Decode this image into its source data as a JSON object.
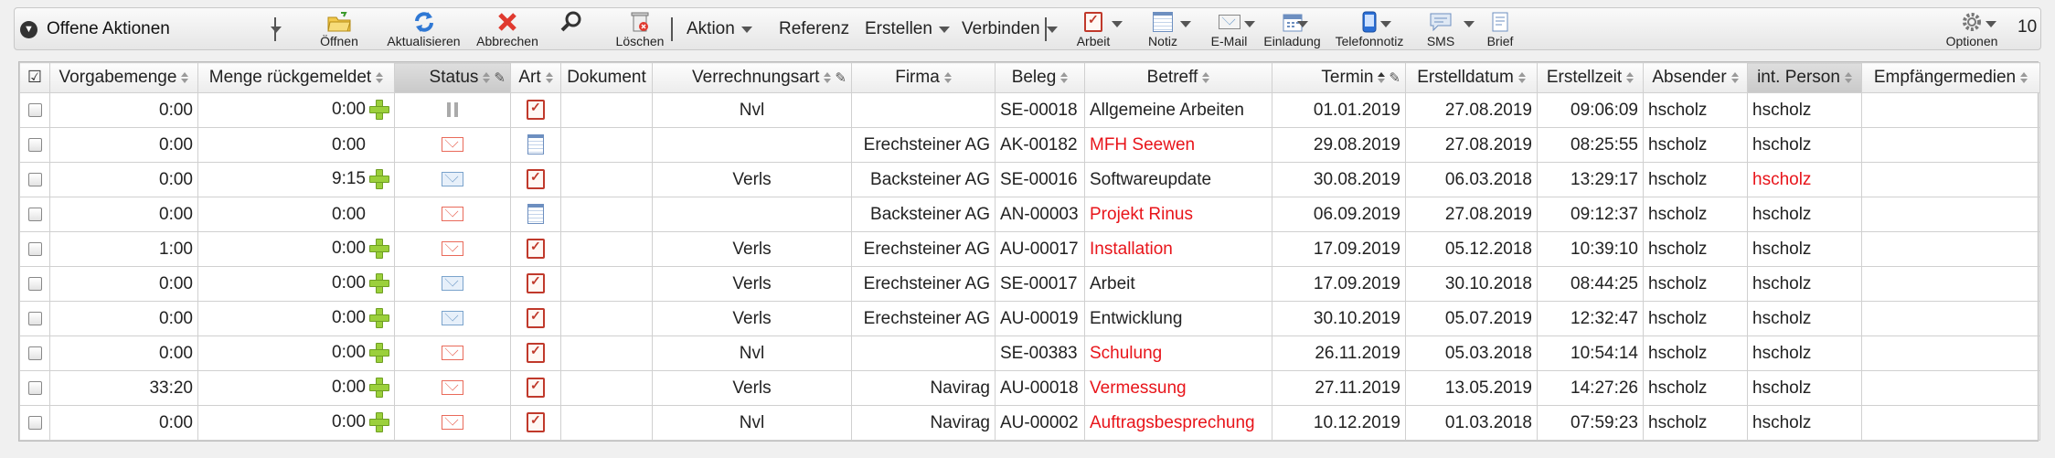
{
  "toolbar": {
    "view_title": "Offene Aktionen",
    "buttons": {
      "open": "Öffnen",
      "refresh": "Aktualisieren",
      "cancel": "Abbrechen",
      "delete": "Löschen",
      "arbeit": "Arbeit",
      "notiz": "Notiz",
      "email": "E-Mail",
      "einladung": "Einladung",
      "telefonnotiz": "Telefonnotiz",
      "sms": "SMS",
      "brief": "Brief",
      "optionen": "Optionen"
    },
    "menus": {
      "aktion": "Aktion",
      "referenz": "Referenz",
      "erstellen": "Erstellen",
      "verbinden": "Verbinden"
    },
    "page_size": "10"
  },
  "columns": {
    "vorgabemenge": "Vorgabemenge",
    "menge": "Menge rückgemeldet",
    "status": "Status",
    "art": "Art",
    "dokument": "Dokument",
    "verrechnungsart": "Verrechnungsart",
    "firma": "Firma",
    "beleg": "Beleg",
    "betreff": "Betreff",
    "termin": "Termin",
    "erstelldatum": "Erstelldatum",
    "erstellzeit": "Erstellzeit",
    "absender": "Absender",
    "int_person": "int. Person",
    "empfaenger": "Empfängermedien"
  },
  "rows": [
    {
      "vorgabe": "0:00",
      "menge": "0:00",
      "plus": true,
      "status": "pause",
      "art": "clip",
      "verr": "Nvl",
      "firma": "",
      "beleg": "SE-00018",
      "betreff": "Allgemeine Arbeiten",
      "betreff_red": false,
      "termin": "01.01.2019",
      "erstelldatum": "27.08.2019",
      "erstellzeit": "09:06:09",
      "absender": "hscholz",
      "int_person": "hscholz",
      "int_red": false
    },
    {
      "vorgabe": "0:00",
      "menge": "0:00",
      "plus": false,
      "status": "mail-red",
      "art": "note",
      "verr": "",
      "firma": "Erechsteiner AG",
      "beleg": "AK-00182",
      "betreff": "MFH Seewen",
      "betreff_red": true,
      "termin": "29.08.2019",
      "erstelldatum": "27.08.2019",
      "erstellzeit": "08:25:55",
      "absender": "hscholz",
      "int_person": "hscholz",
      "int_red": false
    },
    {
      "vorgabe": "0:00",
      "menge": "9:15",
      "plus": true,
      "status": "mail-blue",
      "art": "clip",
      "verr": "Verls",
      "firma": "Backsteiner AG",
      "beleg": "SE-00016",
      "betreff": "Softwareupdate",
      "betreff_red": false,
      "termin": "30.08.2019",
      "erstelldatum": "06.03.2018",
      "erstellzeit": "13:29:17",
      "absender": "hscholz",
      "int_person": "hscholz",
      "int_red": true
    },
    {
      "vorgabe": "0:00",
      "menge": "0:00",
      "plus": false,
      "status": "mail-red",
      "art": "note",
      "verr": "",
      "firma": "Backsteiner AG",
      "beleg": "AN-00003",
      "betreff": "Projekt Rinus",
      "betreff_red": true,
      "termin": "06.09.2019",
      "erstelldatum": "27.08.2019",
      "erstellzeit": "09:12:37",
      "absender": "hscholz",
      "int_person": "hscholz",
      "int_red": false
    },
    {
      "vorgabe": "1:00",
      "menge": "0:00",
      "plus": true,
      "status": "mail-red",
      "art": "clip",
      "verr": "Verls",
      "firma": "Erechsteiner AG",
      "beleg": "AU-00017",
      "betreff": "Installation",
      "betreff_red": true,
      "termin": "17.09.2019",
      "erstelldatum": "05.12.2018",
      "erstellzeit": "10:39:10",
      "absender": "hscholz",
      "int_person": "hscholz",
      "int_red": false
    },
    {
      "vorgabe": "0:00",
      "menge": "0:00",
      "plus": true,
      "status": "mail-blue",
      "art": "clip",
      "verr": "Verls",
      "firma": "Erechsteiner AG",
      "beleg": "SE-00017",
      "betreff": "Arbeit",
      "betreff_red": false,
      "termin": "17.09.2019",
      "erstelldatum": "30.10.2018",
      "erstellzeit": "08:44:25",
      "absender": "hscholz",
      "int_person": "hscholz",
      "int_red": false
    },
    {
      "vorgabe": "0:00",
      "menge": "0:00",
      "plus": true,
      "status": "mail-blue",
      "art": "clip",
      "verr": "Verls",
      "firma": "Erechsteiner AG",
      "beleg": "AU-00019",
      "betreff": "Entwicklung",
      "betreff_red": false,
      "termin": "30.10.2019",
      "erstelldatum": "05.07.2019",
      "erstellzeit": "12:32:47",
      "absender": "hscholz",
      "int_person": "hscholz",
      "int_red": false
    },
    {
      "vorgabe": "0:00",
      "menge": "0:00",
      "plus": true,
      "status": "mail-red",
      "art": "clip",
      "verr": "Nvl",
      "firma": "",
      "beleg": "SE-00383",
      "betreff": "Schulung",
      "betreff_red": true,
      "termin": "26.11.2019",
      "erstelldatum": "05.03.2018",
      "erstellzeit": "10:54:14",
      "absender": "hscholz",
      "int_person": "hscholz",
      "int_red": false
    },
    {
      "vorgabe": "33:20",
      "menge": "0:00",
      "plus": true,
      "status": "mail-red",
      "art": "clip",
      "verr": "Verls",
      "firma": "Navirag",
      "beleg": "AU-00018",
      "betreff": "Vermessung",
      "betreff_red": true,
      "termin": "27.11.2019",
      "erstelldatum": "13.05.2019",
      "erstellzeit": "14:27:26",
      "absender": "hscholz",
      "int_person": "hscholz",
      "int_red": false
    },
    {
      "vorgabe": "0:00",
      "menge": "0:00",
      "plus": true,
      "status": "mail-red",
      "art": "clip",
      "verr": "Nvl",
      "firma": "Navirag",
      "beleg": "AU-00002",
      "betreff": "Auftragsbesprechung",
      "betreff_red": true,
      "termin": "10.12.2019",
      "erstelldatum": "01.03.2018",
      "erstellzeit": "07:59:23",
      "absender": "hscholz",
      "int_person": "hscholz",
      "int_red": false
    }
  ]
}
